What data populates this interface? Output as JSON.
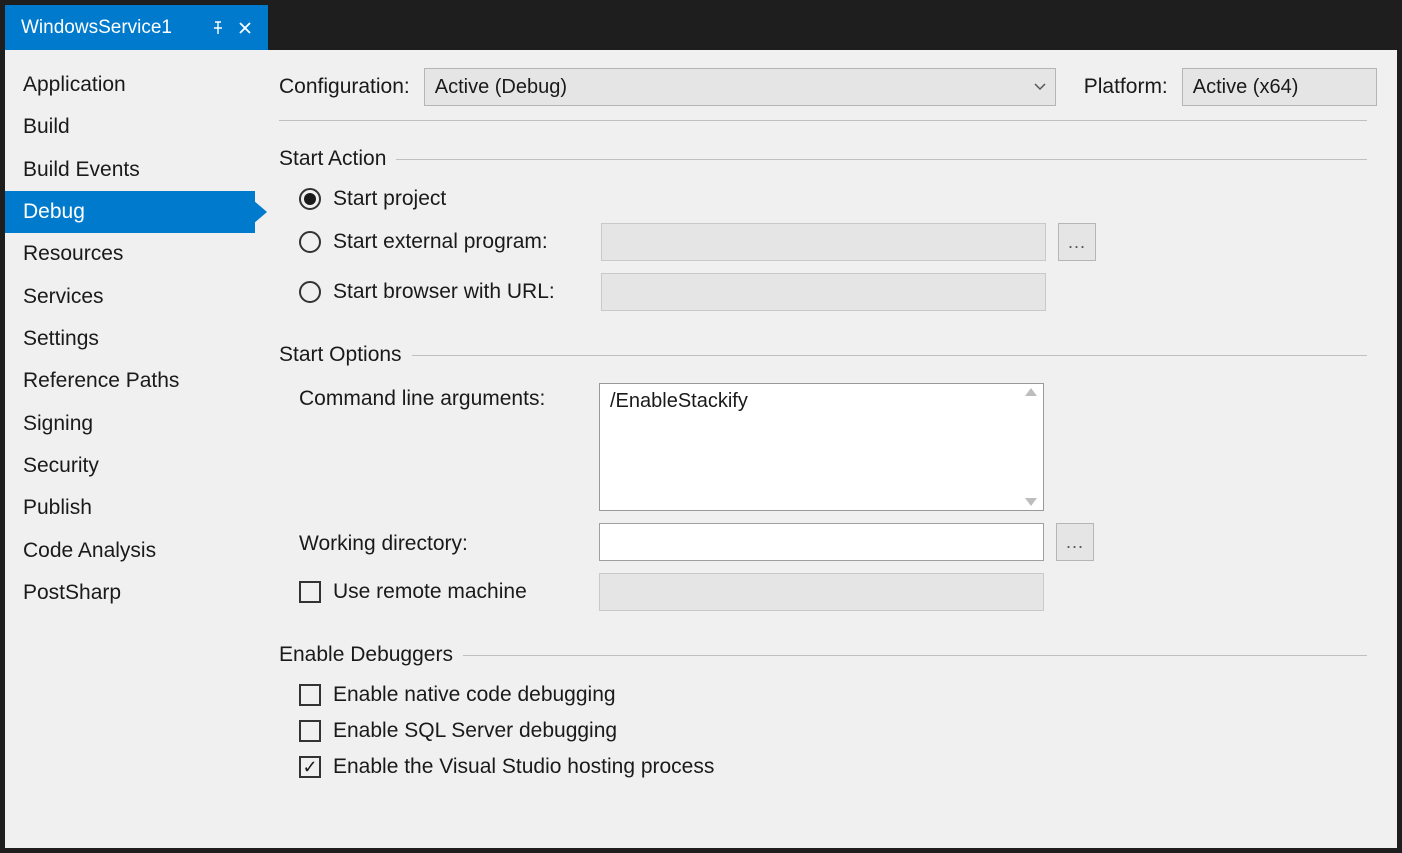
{
  "tab": {
    "title": "WindowsService1"
  },
  "sidebar": {
    "items": [
      "Application",
      "Build",
      "Build Events",
      "Debug",
      "Resources",
      "Services",
      "Settings",
      "Reference Paths",
      "Signing",
      "Security",
      "Publish",
      "Code Analysis",
      "PostSharp"
    ],
    "selected": 3
  },
  "top": {
    "configuration_label": "Configuration:",
    "configuration_value": "Active (Debug)",
    "platform_label": "Platform:",
    "platform_value": "Active (x64)"
  },
  "start_action": {
    "heading": "Start Action",
    "opt_project": "Start project",
    "opt_external": "Start external program:",
    "opt_browser": "Start browser with URL:",
    "selected": "project",
    "external_value": "",
    "browser_value": ""
  },
  "start_options": {
    "heading": "Start Options",
    "cmd_label": "Command line arguments:",
    "cmd_value": "/EnableStackify",
    "workdir_label": "Working directory:",
    "workdir_value": "",
    "remote_label": "Use remote machine",
    "remote_checked": false,
    "remote_value": ""
  },
  "debuggers": {
    "heading": "Enable Debuggers",
    "native_label": "Enable native code debugging",
    "native_checked": false,
    "sql_label": "Enable SQL Server debugging",
    "sql_checked": false,
    "hosting_label": "Enable the Visual Studio hosting process",
    "hosting_checked": true
  },
  "browse_label": "..."
}
